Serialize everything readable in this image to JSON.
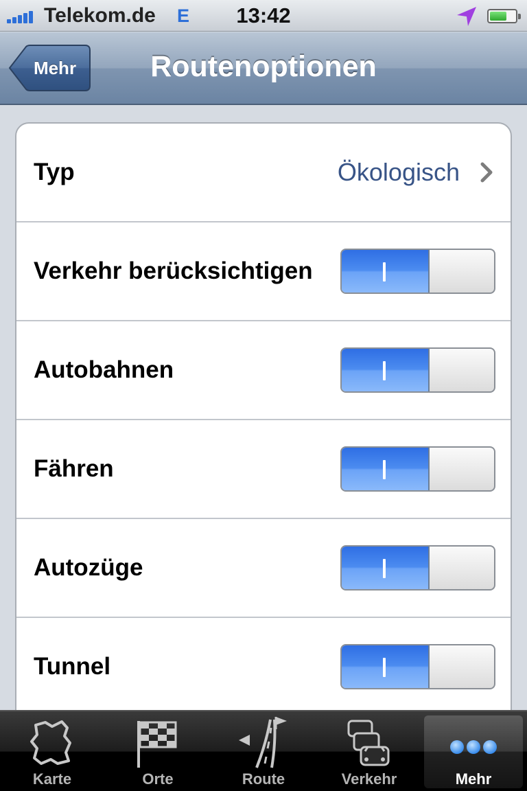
{
  "status_bar": {
    "carrier": "Telekom.de",
    "network": "E",
    "time": "13:42",
    "icons": [
      "signal-icon",
      "location-arrow-icon",
      "battery-icon"
    ]
  },
  "nav_bar": {
    "back_label": "Mehr",
    "title": "Routenoptionen"
  },
  "settings": {
    "type_row": {
      "label": "Typ",
      "value": "Ökologisch",
      "icon": "chevron-right-icon"
    },
    "toggles": [
      {
        "label": "Verkehr berücksichtigen",
        "on": true,
        "on_symbol": "I"
      },
      {
        "label": "Autobahnen",
        "on": true,
        "on_symbol": "I"
      },
      {
        "label": "Fähren",
        "on": true,
        "on_symbol": "I"
      },
      {
        "label": "Autozüge",
        "on": true,
        "on_symbol": "I"
      },
      {
        "label": "Tunnel",
        "on": true,
        "on_symbol": "I"
      }
    ]
  },
  "tab_bar": {
    "tabs": [
      {
        "label": "Karte",
        "icon": "map-icon",
        "active": false
      },
      {
        "label": "Orte",
        "icon": "checkered-flag-icon",
        "active": false
      },
      {
        "label": "Route",
        "icon": "road-route-icon",
        "active": false
      },
      {
        "label": "Verkehr",
        "icon": "traffic-cars-icon",
        "active": false
      },
      {
        "label": "Mehr",
        "icon": "more-dots-icon",
        "active": true
      }
    ]
  },
  "colors": {
    "toggle_on": "#3b7ce9",
    "value_text": "#385487",
    "nav_bar": "#7f95b0",
    "network_indicator": "#2d6fd8"
  }
}
